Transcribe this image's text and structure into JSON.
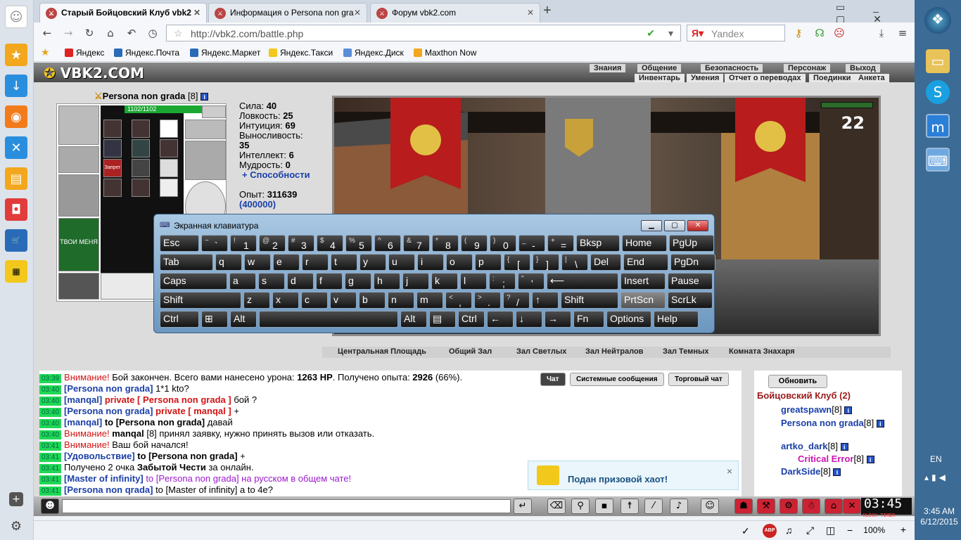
{
  "browser": {
    "tabs": [
      {
        "title": "Старый Бойцовский Клуб vbk2",
        "active": true
      },
      {
        "title": "Информация о Persona non gra",
        "active": false
      },
      {
        "title": "Форум vbk2.com",
        "active": false
      }
    ],
    "new_tab": "+",
    "url": "http://vbk2.com/battle.php",
    "search_placeholder": "Yandex",
    "bookmarks": [
      "Яндекс",
      "Яндекс.Почта",
      "Яндекс.Маркет",
      "Яндекс.Такси",
      "Яндекс.Диск",
      "Maxthon Now"
    ],
    "zoom": "100%"
  },
  "game": {
    "logo": "VBK2.COM",
    "menu_top": [
      "Знания",
      "Общение",
      "Безопасность",
      "Персонаж",
      "Выход"
    ],
    "menu_bottom": [
      "Инвентарь",
      "Умения",
      "Отчет о переводах",
      "Поединки",
      "Анкета"
    ],
    "character": {
      "name": "Persona non grada",
      "level": "[8]",
      "hp": "1102/1102"
    },
    "stats": [
      {
        "label": "Сила:",
        "value": "40"
      },
      {
        "label": "Ловкость:",
        "value": "25"
      },
      {
        "label": "Интуиция:",
        "value": "69"
      },
      {
        "label": "Выносливость:",
        "value": "35"
      },
      {
        "label": "Интеллект:",
        "value": "6"
      },
      {
        "label": "Мудрость:",
        "value": "0"
      }
    ],
    "abilities": "+ Способности",
    "exp_label": "Опыт:",
    "exp": "311639",
    "exp_next": "(400000)",
    "slot_labels": {
      "ban": "Запрет",
      "shirt": "ТВОИ МЕНЯ"
    },
    "battle_timer": "22",
    "rooms": [
      "Центральная Площадь",
      "Общий Зал",
      "Зал Светлых",
      "Зал Нейтралов",
      "Зал Темных",
      "Комната Знахаря"
    ]
  },
  "chat": {
    "tabs": [
      "Чат",
      "Системные сообщения",
      "Торговый чат"
    ],
    "lines": [
      {
        "t": "03:39",
        "parts": [
          {
            "c": "red",
            "x": "Внимание!"
          },
          {
            "c": "",
            "x": " Бой закончен. Всего вами нанесено урона: "
          },
          {
            "c": "b",
            "x": "1263 HP"
          },
          {
            "c": "",
            "x": ". Получено опыта: "
          },
          {
            "c": "b",
            "x": "2926"
          },
          {
            "c": "",
            "x": " (66%)."
          }
        ]
      },
      {
        "t": "03:40",
        "parts": [
          {
            "c": "nav",
            "x": "[Persona non grada]"
          },
          {
            "c": "",
            "x": " 1*1 kto?"
          }
        ]
      },
      {
        "t": "03:40",
        "parts": [
          {
            "c": "nav",
            "x": "[manqal]"
          },
          {
            "c": "priv",
            "x": " private [ Persona non grada ]"
          },
          {
            "c": "",
            "x": " бой ?"
          }
        ]
      },
      {
        "t": "03:40",
        "parts": [
          {
            "c": "nav",
            "x": "[Persona non grada]"
          },
          {
            "c": "priv",
            "x": " private [ manqal ]"
          },
          {
            "c": "",
            "x": " +"
          }
        ]
      },
      {
        "t": "03:40",
        "parts": [
          {
            "c": "nav",
            "x": "[manqal]"
          },
          {
            "c": "b",
            "x": " to [Persona non grada]"
          },
          {
            "c": "",
            "x": " давай"
          }
        ]
      },
      {
        "t": "03:40",
        "parts": [
          {
            "c": "red",
            "x": "Внимание!"
          },
          {
            "c": "b",
            "x": "      manqal"
          },
          {
            "c": "",
            "x": " [8] принял заявку, нужно принять вызов или отказать."
          }
        ]
      },
      {
        "t": "03:41",
        "parts": [
          {
            "c": "red",
            "x": "Внимание!"
          },
          {
            "c": "",
            "x": " Ваш бой начался!"
          }
        ]
      },
      {
        "t": "03:41",
        "parts": [
          {
            "c": "nav",
            "x": "[Удовольствие]"
          },
          {
            "c": "b",
            "x": " to [Persona non grada]"
          },
          {
            "c": "",
            "x": " +"
          }
        ]
      },
      {
        "t": "03:41",
        "parts": [
          {
            "c": "",
            "x": "Получено 2 очка "
          },
          {
            "c": "b",
            "x": "Забытой Чести"
          },
          {
            "c": "",
            "x": " за онлайн."
          }
        ]
      },
      {
        "t": "03:41",
        "parts": [
          {
            "c": "nav",
            "x": "[Master of infinity]"
          },
          {
            "c": "purple",
            "x": " to [Persona non grada] на русском в общем чате!"
          }
        ]
      },
      {
        "t": "03:41",
        "parts": [
          {
            "c": "nav",
            "x": "[Persona non qrada]"
          },
          {
            "c": "",
            "x": " to [Master of infinity] а to 4е?"
          }
        ]
      }
    ]
  },
  "online": {
    "refresh": "Обновить",
    "header": "Бойцовский Клуб (2)",
    "users": [
      {
        "name": "greatspawn",
        "level": "[8]"
      },
      {
        "name": "Persona non grada",
        "level": "[8]"
      },
      {
        "name": "artko_dark",
        "level": "[8]"
      },
      {
        "name": "Critical Error",
        "level": "[8]"
      },
      {
        "name": "DarkSide",
        "level": "[8]"
      }
    ]
  },
  "notification": {
    "text": "Подан призовой хаот!",
    "close": "×"
  },
  "clock": {
    "time": "03:45",
    "label": "CLOCK TIMER"
  },
  "osk": {
    "title": "Экранная клавиатура",
    "rows": [
      [
        "Esc",
        "~ `",
        "! 1",
        "@ 2",
        "# 3",
        "$ 4",
        "% 5",
        "^ 6",
        "& 7",
        "* 8",
        "( 9",
        ") 0",
        "_ -",
        "+ =",
        "Bksp",
        "Home",
        "PgUp"
      ],
      [
        "Tab",
        "q",
        "w",
        "e",
        "r",
        "t",
        "y",
        "u",
        "i",
        "o",
        "p",
        "{ [",
        "} ]",
        "| \\",
        "Del",
        "End",
        "PgDn"
      ],
      [
        "Caps",
        "a",
        "s",
        "d",
        "f",
        "g",
        "h",
        "j",
        "k",
        "l",
        ": ;",
        "\" '",
        "⟵",
        "Insert",
        "Pause"
      ],
      [
        "Shift",
        "z",
        "x",
        "c",
        "v",
        "b",
        "n",
        "m",
        "< ,",
        "> .",
        "? /",
        "↑",
        "Shift",
        "PrtScn",
        "ScrLk"
      ],
      [
        "Ctrl",
        "⊞",
        "Alt",
        "",
        "Alt",
        "▤",
        "Ctrl",
        "←",
        "↓",
        "→",
        "Fn",
        "Options",
        "Help"
      ]
    ]
  },
  "taskbar": {
    "lang": "EN",
    "time": "3:45 AM",
    "date": "6/12/2015"
  }
}
